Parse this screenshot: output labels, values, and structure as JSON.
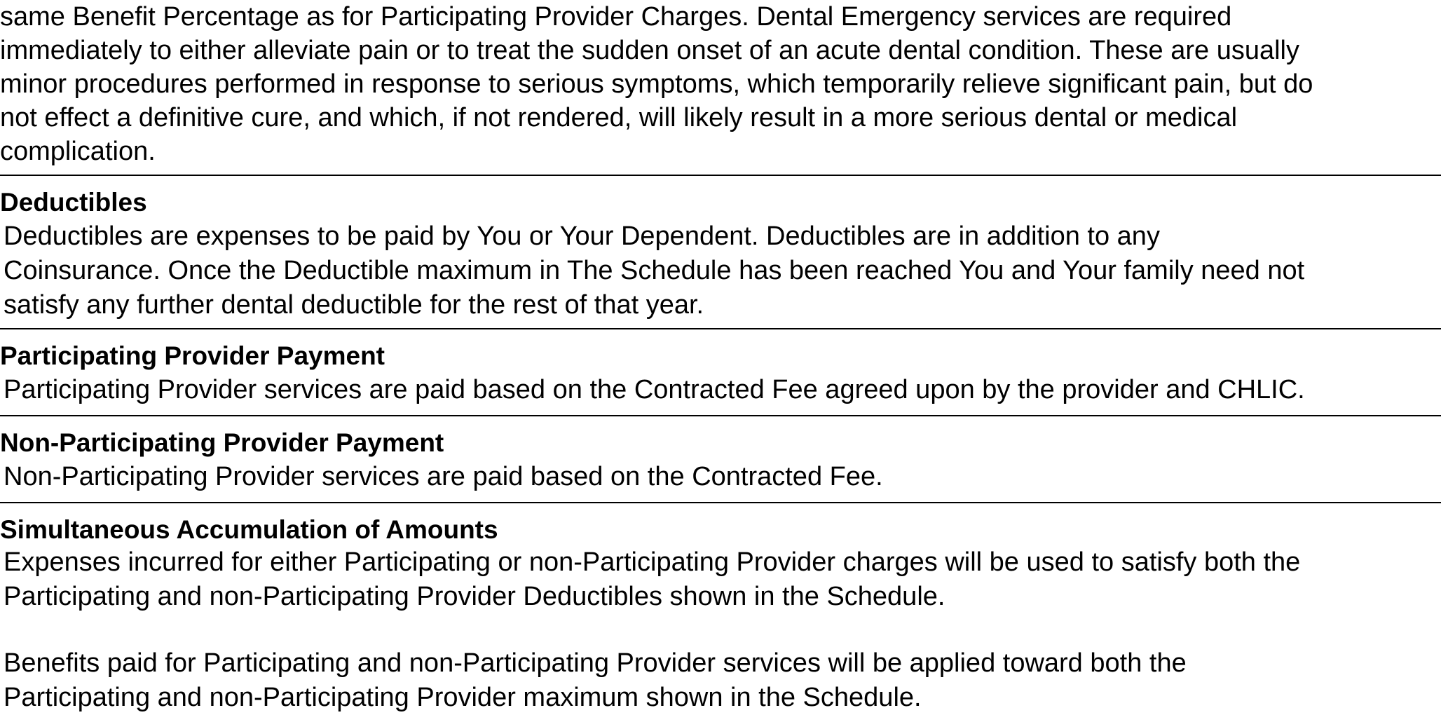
{
  "intro": {
    "text": "same Benefit Percentage as for Participating Provider Charges. Dental Emergency services are required\nimmediately to either alleviate pain or to treat the sudden onset of an acute dental condition. These are usually\nminor procedures performed in response to serious symptoms, which temporarily relieve significant pain, but do\nnot effect a definitive cure, and which, if not rendered, will likely result in a more serious dental or medical\ncomplication."
  },
  "sections": {
    "deductibles": {
      "heading": "Deductibles",
      "body": "Deductibles are expenses to be paid by You or Your Dependent.  Deductibles are in addition to any\nCoinsurance.  Once the Deductible maximum in The Schedule has been reached You and Your family need not\nsatisfy any further dental deductible for the rest of that year."
    },
    "participating": {
      "heading": "Participating Provider Payment",
      "body": "Participating Provider services are paid based on the Contracted Fee agreed upon by the provider and CHLIC."
    },
    "non_participating": {
      "heading": "Non-Participating Provider Payment",
      "body": "Non-Participating Provider services are paid based on the Contracted Fee."
    },
    "simultaneous": {
      "heading": "Simultaneous Accumulation of Amounts",
      "body_1": "Expenses incurred for either Participating or non-Participating Provider charges will be used to satisfy both the\nParticipating and non-Participating Provider Deductibles shown in the Schedule.",
      "body_2": "Benefits paid for Participating and non-Participating Provider services will be applied toward both the\nParticipating and non-Participating Provider maximum shown in the Schedule."
    }
  }
}
